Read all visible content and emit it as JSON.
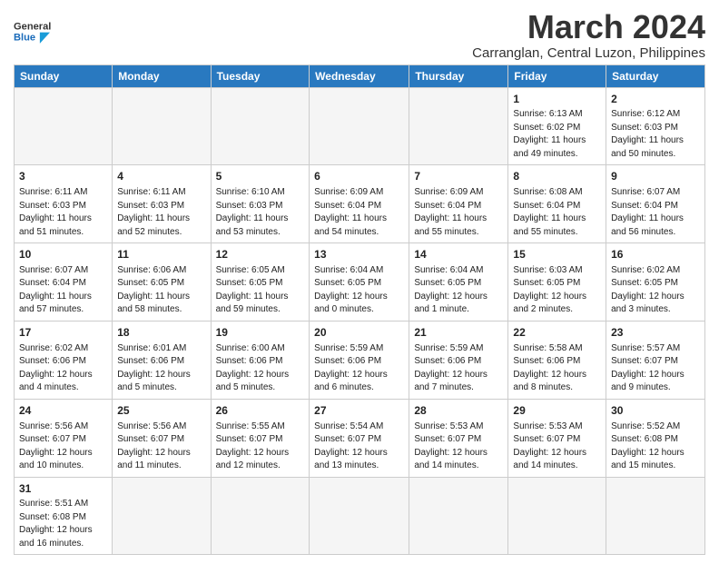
{
  "header": {
    "logo_general": "General",
    "logo_blue": "Blue",
    "month_title": "March 2024",
    "subtitle": "Carranglan, Central Luzon, Philippines"
  },
  "days_of_week": [
    "Sunday",
    "Monday",
    "Tuesday",
    "Wednesday",
    "Thursday",
    "Friday",
    "Saturday"
  ],
  "weeks": [
    [
      {
        "day": "",
        "info": ""
      },
      {
        "day": "",
        "info": ""
      },
      {
        "day": "",
        "info": ""
      },
      {
        "day": "",
        "info": ""
      },
      {
        "day": "",
        "info": ""
      },
      {
        "day": "1",
        "info": "Sunrise: 6:13 AM\nSunset: 6:02 PM\nDaylight: 11 hours\nand 49 minutes."
      },
      {
        "day": "2",
        "info": "Sunrise: 6:12 AM\nSunset: 6:03 PM\nDaylight: 11 hours\nand 50 minutes."
      }
    ],
    [
      {
        "day": "3",
        "info": "Sunrise: 6:11 AM\nSunset: 6:03 PM\nDaylight: 11 hours\nand 51 minutes."
      },
      {
        "day": "4",
        "info": "Sunrise: 6:11 AM\nSunset: 6:03 PM\nDaylight: 11 hours\nand 52 minutes."
      },
      {
        "day": "5",
        "info": "Sunrise: 6:10 AM\nSunset: 6:03 PM\nDaylight: 11 hours\nand 53 minutes."
      },
      {
        "day": "6",
        "info": "Sunrise: 6:09 AM\nSunset: 6:04 PM\nDaylight: 11 hours\nand 54 minutes."
      },
      {
        "day": "7",
        "info": "Sunrise: 6:09 AM\nSunset: 6:04 PM\nDaylight: 11 hours\nand 55 minutes."
      },
      {
        "day": "8",
        "info": "Sunrise: 6:08 AM\nSunset: 6:04 PM\nDaylight: 11 hours\nand 55 minutes."
      },
      {
        "day": "9",
        "info": "Sunrise: 6:07 AM\nSunset: 6:04 PM\nDaylight: 11 hours\nand 56 minutes."
      }
    ],
    [
      {
        "day": "10",
        "info": "Sunrise: 6:07 AM\nSunset: 6:04 PM\nDaylight: 11 hours\nand 57 minutes."
      },
      {
        "day": "11",
        "info": "Sunrise: 6:06 AM\nSunset: 6:05 PM\nDaylight: 11 hours\nand 58 minutes."
      },
      {
        "day": "12",
        "info": "Sunrise: 6:05 AM\nSunset: 6:05 PM\nDaylight: 11 hours\nand 59 minutes."
      },
      {
        "day": "13",
        "info": "Sunrise: 6:04 AM\nSunset: 6:05 PM\nDaylight: 12 hours\nand 0 minutes."
      },
      {
        "day": "14",
        "info": "Sunrise: 6:04 AM\nSunset: 6:05 PM\nDaylight: 12 hours\nand 1 minute."
      },
      {
        "day": "15",
        "info": "Sunrise: 6:03 AM\nSunset: 6:05 PM\nDaylight: 12 hours\nand 2 minutes."
      },
      {
        "day": "16",
        "info": "Sunrise: 6:02 AM\nSunset: 6:05 PM\nDaylight: 12 hours\nand 3 minutes."
      }
    ],
    [
      {
        "day": "17",
        "info": "Sunrise: 6:02 AM\nSunset: 6:06 PM\nDaylight: 12 hours\nand 4 minutes."
      },
      {
        "day": "18",
        "info": "Sunrise: 6:01 AM\nSunset: 6:06 PM\nDaylight: 12 hours\nand 5 minutes."
      },
      {
        "day": "19",
        "info": "Sunrise: 6:00 AM\nSunset: 6:06 PM\nDaylight: 12 hours\nand 5 minutes."
      },
      {
        "day": "20",
        "info": "Sunrise: 5:59 AM\nSunset: 6:06 PM\nDaylight: 12 hours\nand 6 minutes."
      },
      {
        "day": "21",
        "info": "Sunrise: 5:59 AM\nSunset: 6:06 PM\nDaylight: 12 hours\nand 7 minutes."
      },
      {
        "day": "22",
        "info": "Sunrise: 5:58 AM\nSunset: 6:06 PM\nDaylight: 12 hours\nand 8 minutes."
      },
      {
        "day": "23",
        "info": "Sunrise: 5:57 AM\nSunset: 6:07 PM\nDaylight: 12 hours\nand 9 minutes."
      }
    ],
    [
      {
        "day": "24",
        "info": "Sunrise: 5:56 AM\nSunset: 6:07 PM\nDaylight: 12 hours\nand 10 minutes."
      },
      {
        "day": "25",
        "info": "Sunrise: 5:56 AM\nSunset: 6:07 PM\nDaylight: 12 hours\nand 11 minutes."
      },
      {
        "day": "26",
        "info": "Sunrise: 5:55 AM\nSunset: 6:07 PM\nDaylight: 12 hours\nand 12 minutes."
      },
      {
        "day": "27",
        "info": "Sunrise: 5:54 AM\nSunset: 6:07 PM\nDaylight: 12 hours\nand 13 minutes."
      },
      {
        "day": "28",
        "info": "Sunrise: 5:53 AM\nSunset: 6:07 PM\nDaylight: 12 hours\nand 14 minutes."
      },
      {
        "day": "29",
        "info": "Sunrise: 5:53 AM\nSunset: 6:07 PM\nDaylight: 12 hours\nand 14 minutes."
      },
      {
        "day": "30",
        "info": "Sunrise: 5:52 AM\nSunset: 6:08 PM\nDaylight: 12 hours\nand 15 minutes."
      }
    ],
    [
      {
        "day": "31",
        "info": "Sunrise: 5:51 AM\nSunset: 6:08 PM\nDaylight: 12 hours\nand 16 minutes."
      },
      {
        "day": "",
        "info": ""
      },
      {
        "day": "",
        "info": ""
      },
      {
        "day": "",
        "info": ""
      },
      {
        "day": "",
        "info": ""
      },
      {
        "day": "",
        "info": ""
      },
      {
        "day": "",
        "info": ""
      }
    ]
  ]
}
